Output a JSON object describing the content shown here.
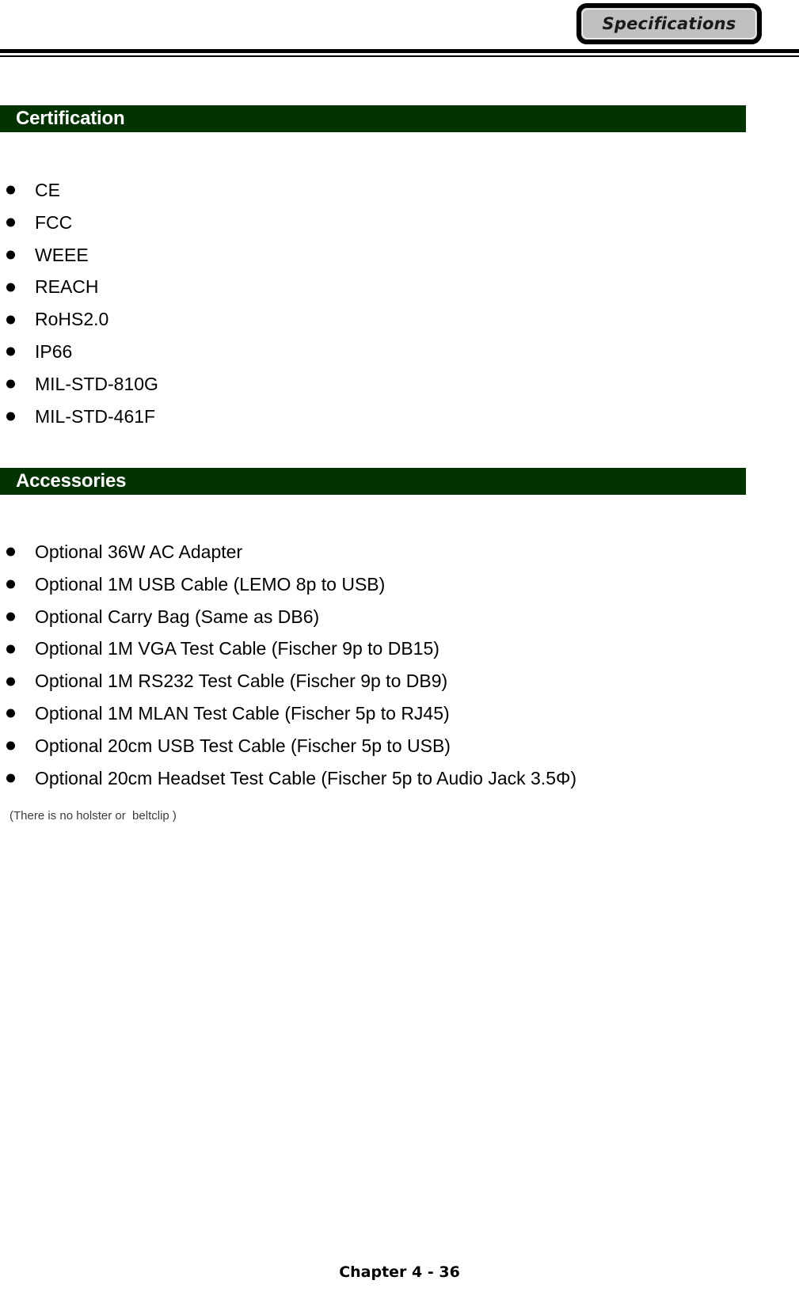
{
  "page": {
    "header_tab_label": "Specifications",
    "footer_label": "Chapter 4 - 36",
    "accent_green": "#033300",
    "tab_fill": "#c0c0c0"
  },
  "sections": [
    {
      "id": "certification",
      "title": "Certification",
      "items": [
        "CE",
        "FCC",
        "WEEE",
        "REACH",
        "RoHS2.0",
        "IP66",
        "MIL-STD-810G",
        "MIL-STD-461F"
      ]
    },
    {
      "id": "accessories",
      "title": "Accessories",
      "items": [
        "Optional 36W AC Adapter",
        "Optional 1M USB Cable (LEMO 8p to USB)",
        "Optional Carry Bag (Same as DB6)",
        "Optional 1M VGA Test Cable (Fischer 9p to DB15)",
        "Optional 1M RS232 Test Cable (Fischer 9p to DB9)",
        "Optional 1M MLAN Test Cable (Fischer 5p to RJ45)",
        "Optional 20cm USB Test Cable (Fischer 5p to USB)",
        "Optional 20cm Headset Test Cable (Fischer 5p to Audio Jack 3.5Φ)"
      ],
      "note": "(There is no holster or  beltclip )"
    }
  ]
}
